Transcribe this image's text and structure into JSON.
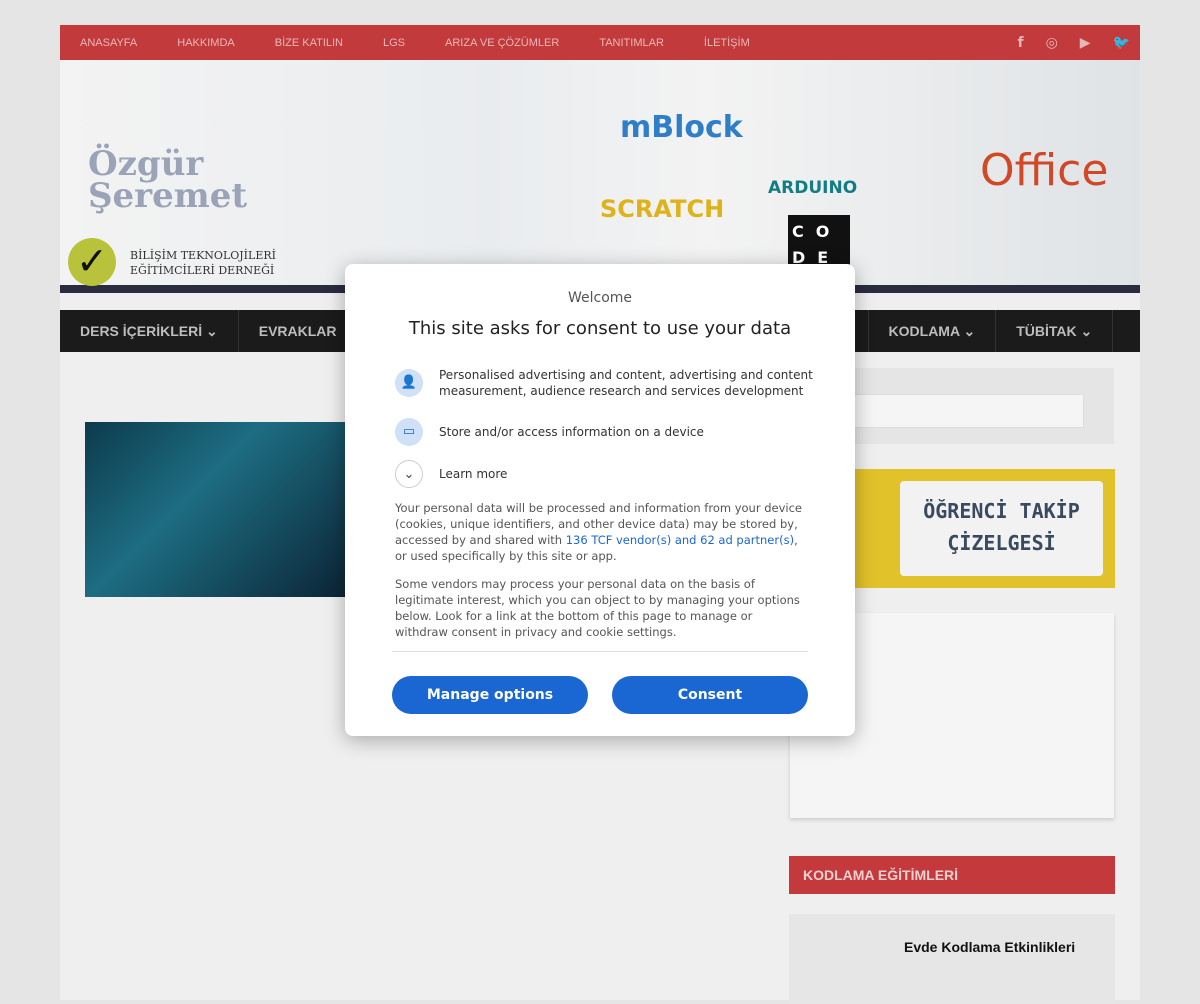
{
  "topnav": {
    "items": [
      "ANASAYFA",
      "HAKKIMDA",
      "BİZE KATILIN",
      "LGS",
      "ARIZA VE ÇÖZÜMLER",
      "TANITIMLAR",
      "İLETİŞİM"
    ],
    "social": [
      "facebook-icon",
      "instagram-icon",
      "youtube-icon",
      "twitter-icon"
    ]
  },
  "banner": {
    "logo_line1": "Özgür",
    "logo_line2": "Şeremet",
    "assoc_line1": "BİLİŞİM TEKNOLOJİLERİ",
    "assoc_line2": "EĞİTİMCİLERİ DERNEĞİ",
    "brands": [
      "mBlock",
      "SCRATCH",
      "ARDUINO",
      "CODE",
      "Office"
    ]
  },
  "mainnav": {
    "items": [
      "DERS İÇERİKLERİ ⌄",
      "EVRAKLAR",
      "KODLAMA ⌄",
      "TÜBİTAK ⌄"
    ]
  },
  "sidebar": {
    "search_placeholder": "...",
    "ad_text": "ÖĞRENCİ TAKİP ÇİZELGESİ",
    "widget_title": "KODLAMA EĞİTİMLERİ",
    "widget_item": "Evde Kodlama Etkinlikleri"
  },
  "modal": {
    "welcome": "Welcome",
    "title": "This site asks for consent to use your data",
    "purposes": [
      "Personalised advertising and content, advertising and content measurement, audience research and services development",
      "Store and/or access information on a device"
    ],
    "learn_more": "Learn more",
    "para1_a": "Your personal data will be processed and information from your device (cookies, unique identifiers, and other device data) may be stored by, accessed by and shared with ",
    "para1_link": "136 TCF vendor(s) and 62 ad partner(s)",
    "para1_b": ", or used specifically by this site or app.",
    "para2": "Some vendors may process your personal data on the basis of legitimate interest, which you can object to by managing your options below. Look for a link at the bottom of this page to manage or withdraw consent in privacy and cookie settings.",
    "manage": "Manage options",
    "consent": "Consent"
  },
  "colors": {
    "accent": "#1a66d3",
    "topbar": "#c33a3c"
  }
}
